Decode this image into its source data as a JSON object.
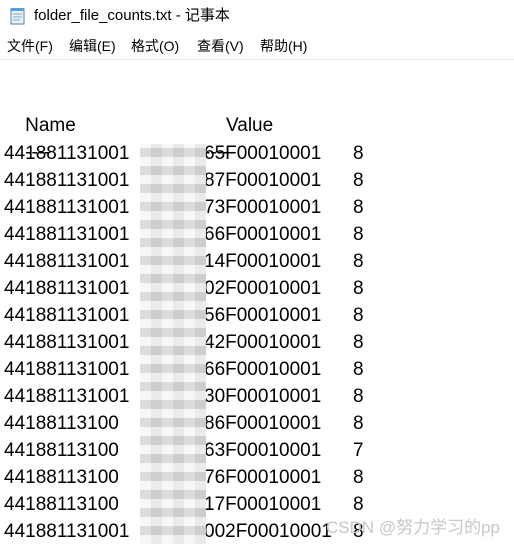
{
  "window": {
    "title": "folder_file_counts.txt - 记事本",
    "icon": "notepad-icon"
  },
  "menu": [
    {
      "label": "文件(F)"
    },
    {
      "label": "编辑(E)"
    },
    {
      "label": "格式(O)"
    },
    {
      "label": "查看(V)"
    },
    {
      "label": "帮助(H)"
    }
  ],
  "content": {
    "header_name": "Name",
    "header_value": "Value",
    "sep_name": "----",
    "sep_value": "-----",
    "rows": [
      {
        "prefix": "441881131001",
        "suffix": "65F00010001",
        "value": "8"
      },
      {
        "prefix": "441881131001",
        "suffix": "87F00010001",
        "value": "8"
      },
      {
        "prefix": "441881131001",
        "suffix": "73F00010001",
        "value": "8"
      },
      {
        "prefix": "441881131001",
        "suffix": "66F00010001",
        "value": "8"
      },
      {
        "prefix": "441881131001",
        "suffix": "14F00010001",
        "value": "8"
      },
      {
        "prefix": "441881131001",
        "suffix": "02F00010001",
        "value": "8"
      },
      {
        "prefix": "441881131001",
        "suffix": "56F00010001",
        "value": "8"
      },
      {
        "prefix": "441881131001",
        "suffix": "42F00010001",
        "value": "8"
      },
      {
        "prefix": "441881131001",
        "suffix": "66F00010001",
        "value": "8"
      },
      {
        "prefix": "441881131001",
        "suffix": "30F00010001",
        "value": "8"
      },
      {
        "prefix": "44188113100",
        "suffix": "86F00010001",
        "value": "8"
      },
      {
        "prefix": "44188113100",
        "suffix": "63F00010001",
        "value": "7"
      },
      {
        "prefix": "44188113100",
        "suffix": "76F00010001",
        "value": "8"
      },
      {
        "prefix": "44188113100",
        "suffix": "17F00010001",
        "value": "8"
      },
      {
        "prefix": "441881131001",
        "suffix": "002F00010001",
        "value": "8"
      }
    ]
  },
  "watermark": "CSDN @努力学习的pp"
}
